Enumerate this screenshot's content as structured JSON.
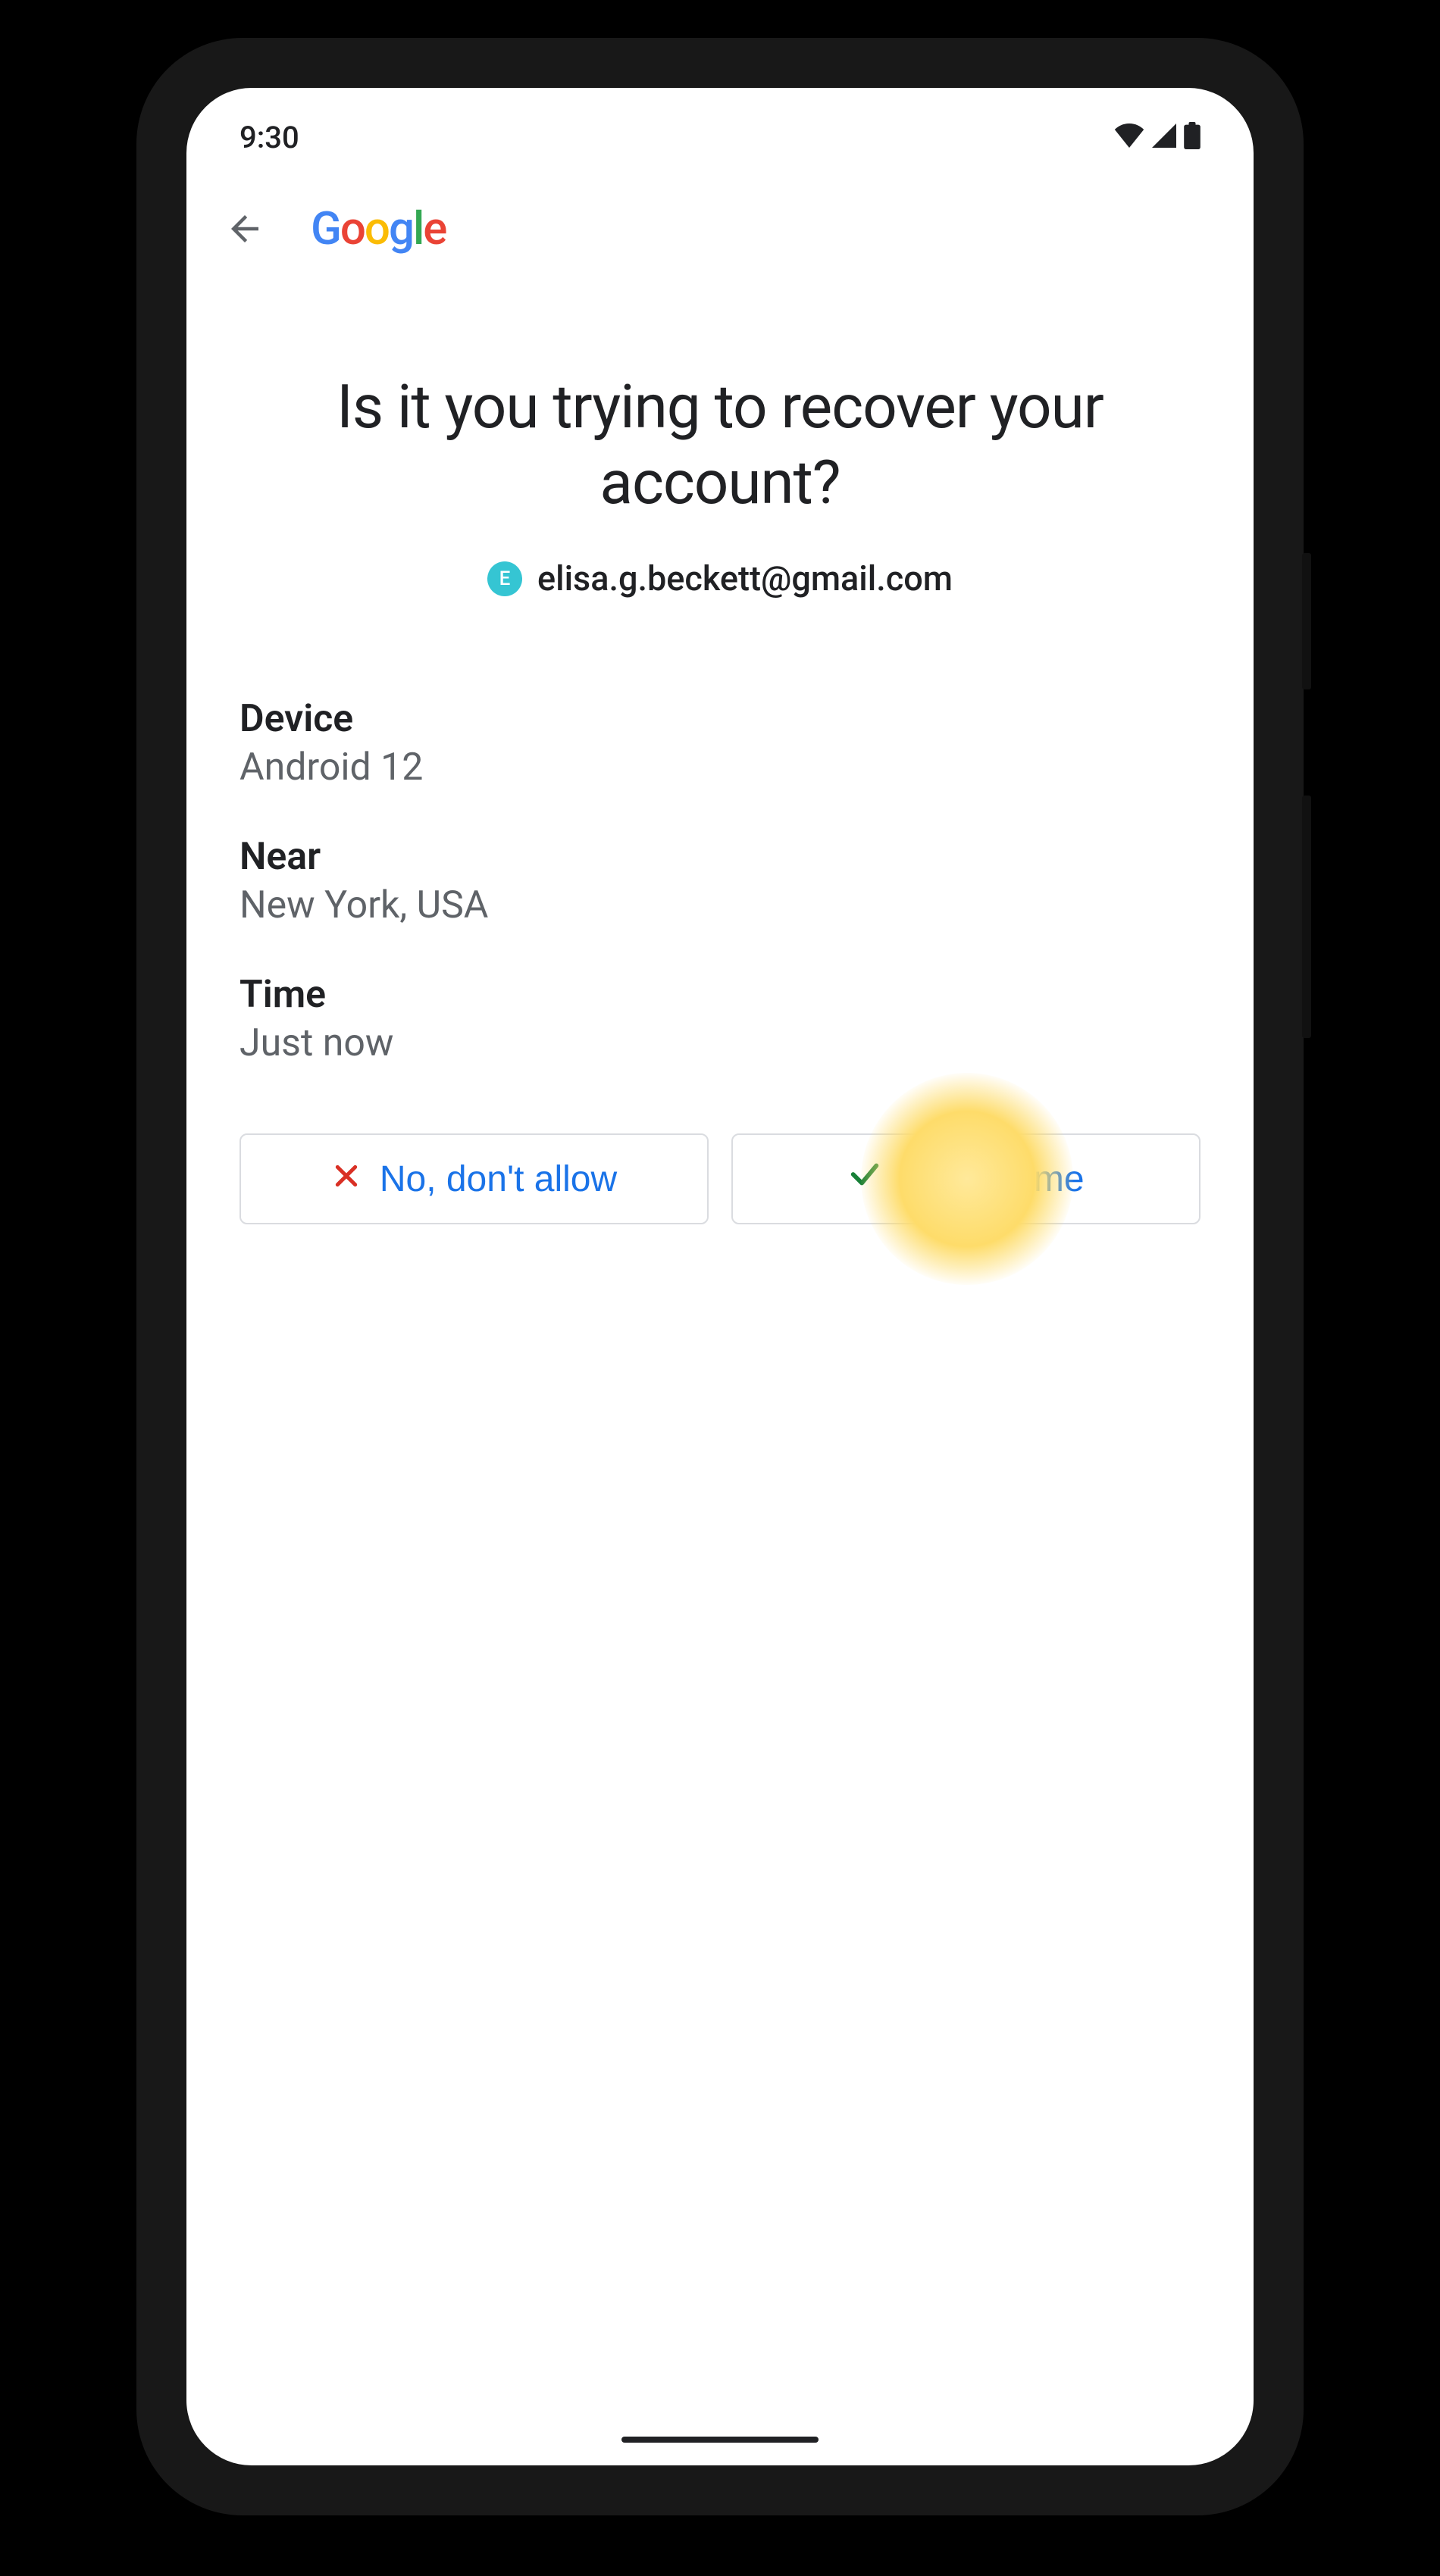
{
  "status": {
    "time": "9:30"
  },
  "header": {
    "brand": {
      "g1": "G",
      "o1": "o",
      "o2": "o",
      "g2": "g",
      "l": "l",
      "e": "e"
    }
  },
  "main": {
    "title": "Is it you trying to recover your account?",
    "avatar_initial": "E",
    "email": "elisa.g.beckett@gmail.com",
    "details": {
      "device_label": "Device",
      "device_value": "Android 12",
      "near_label": "Near",
      "near_value": "New York, USA",
      "time_label": "Time",
      "time_value": "Just now"
    },
    "buttons": {
      "deny": "No, don't allow",
      "allow": "Yes, it's me"
    }
  }
}
